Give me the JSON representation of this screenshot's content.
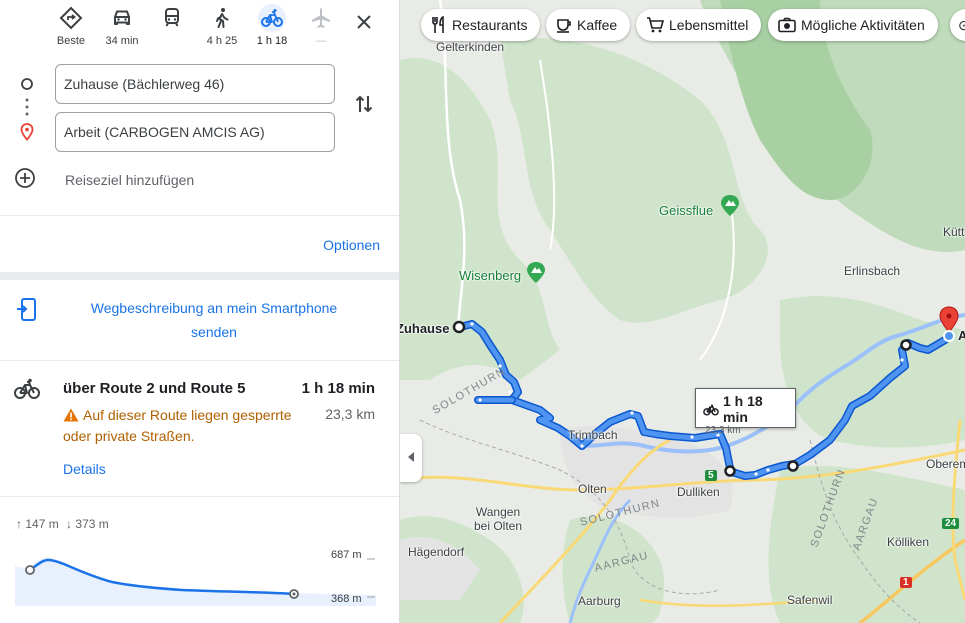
{
  "travel_modes": [
    {
      "name": "best",
      "label": "Beste",
      "icon": "route-diamond-icon",
      "active": false
    },
    {
      "name": "car",
      "label": "34 min",
      "icon": "car-icon",
      "active": false
    },
    {
      "name": "transit",
      "label": "",
      "icon": "train-icon",
      "active": false
    },
    {
      "name": "walk",
      "label": "4 h 25",
      "icon": "walking-icon",
      "active": false
    },
    {
      "name": "bike",
      "label": "1 h 18",
      "icon": "bicycle-icon",
      "active": true
    },
    {
      "name": "flight",
      "label": "—",
      "icon": "airplane-icon",
      "active": false
    }
  ],
  "directions": {
    "origin_value": "Zuhause (Bächlerweg 46)",
    "destination_value": "Arbeit (CARBOGEN AMCIS AG)",
    "add_destination": "Reiseziel hinzufügen"
  },
  "options_label": "Optionen",
  "send_to_phone": "Wegbeschreibung an mein Smartphone senden",
  "route": {
    "title": "über Route 2 und Route 5",
    "duration": "1 h 18 min",
    "distance": "23,3 km",
    "warning": "Auf dieser Route liegen gesperrte oder private Straßen.",
    "details_label": "Details"
  },
  "elevation": {
    "ascent": "147 m",
    "descent": "373 m",
    "max_label": "687 m",
    "min_label": "368 m"
  },
  "map": {
    "chips": [
      {
        "label": "Restaurants",
        "icon": "fork-knife-icon"
      },
      {
        "label": "Kaffee",
        "icon": "coffee-cup-icon"
      },
      {
        "label": "Lebensmittel",
        "icon": "shopping-cart-icon"
      },
      {
        "label": "Mögliche Aktivitäten",
        "icon": "camera-icon"
      }
    ],
    "places": {
      "gelterkinden": "Gelterkinden",
      "geissflue": "Geissflue",
      "wisenberg": "Wisenberg",
      "erlinsbach": "Erlinsbach",
      "kutt": "Kütt",
      "zuhause": "Zuhause",
      "trimbach": "Trimbach",
      "olten": "Olten",
      "dulliken": "Dulliken",
      "wangen": "Wangen bei Olten",
      "hagendorf": "Hägendorf",
      "aarburg": "Aarburg",
      "safenwil": "Safenwil",
      "kolliken": "Kölliken",
      "oberem": "Oberem",
      "destination_short": "A"
    },
    "cantons": {
      "solothurn_1": "SOLOTHURN",
      "solothurn_2": "SOLOTHURN",
      "solothurn_3": "SOLOTHURN",
      "aargau_1": "AARGAU",
      "aargau_2": "AARGAU"
    },
    "road_shields": {
      "r5": "5",
      "r24": "24",
      "r1": "1"
    },
    "route_label": {
      "time": "1 h 18 min",
      "distance": "23,3 km"
    },
    "colors": {
      "route": "#1a73e8",
      "route_outline": "#0b57d0",
      "forest": "#cfe4cb",
      "water": "#9cc0f9",
      "destination_pin": "#ea4335"
    }
  }
}
